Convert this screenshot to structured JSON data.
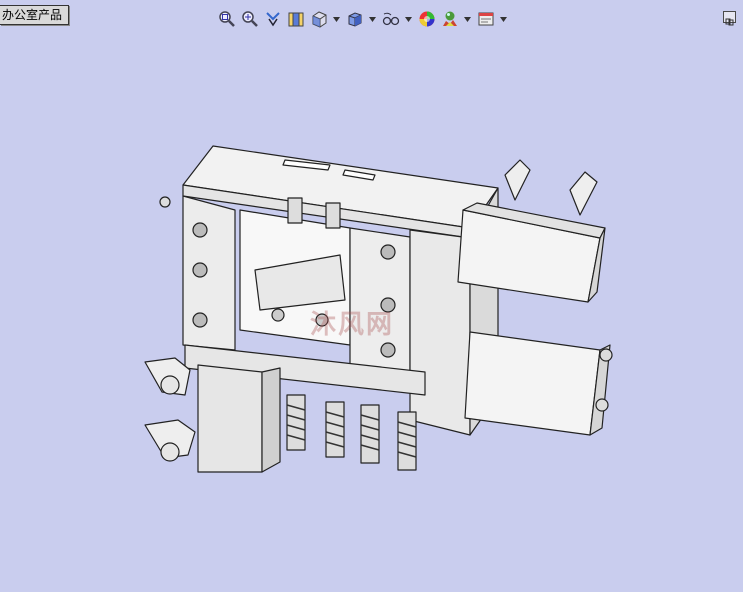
{
  "window": {
    "title": "办公室产品"
  },
  "toolbar": {
    "buttons": [
      {
        "icon": "zoom-to-fit-icon"
      },
      {
        "icon": "zoom-to-area-icon"
      },
      {
        "icon": "previous-view-icon"
      },
      {
        "icon": "section-view-icon"
      },
      {
        "icon": "view-orientation-icon",
        "dropdown": true
      },
      {
        "icon": "display-style-icon",
        "dropdown": true
      },
      {
        "icon": "hide-show-items-icon",
        "dropdown": true
      },
      {
        "icon": "edit-appearance-icon"
      },
      {
        "icon": "apply-scene-icon",
        "dropdown": true
      },
      {
        "icon": "view-settings-icon",
        "dropdown": true
      }
    ]
  },
  "viewport": {
    "background": "#c9cdee",
    "watermark": "沐风网"
  }
}
